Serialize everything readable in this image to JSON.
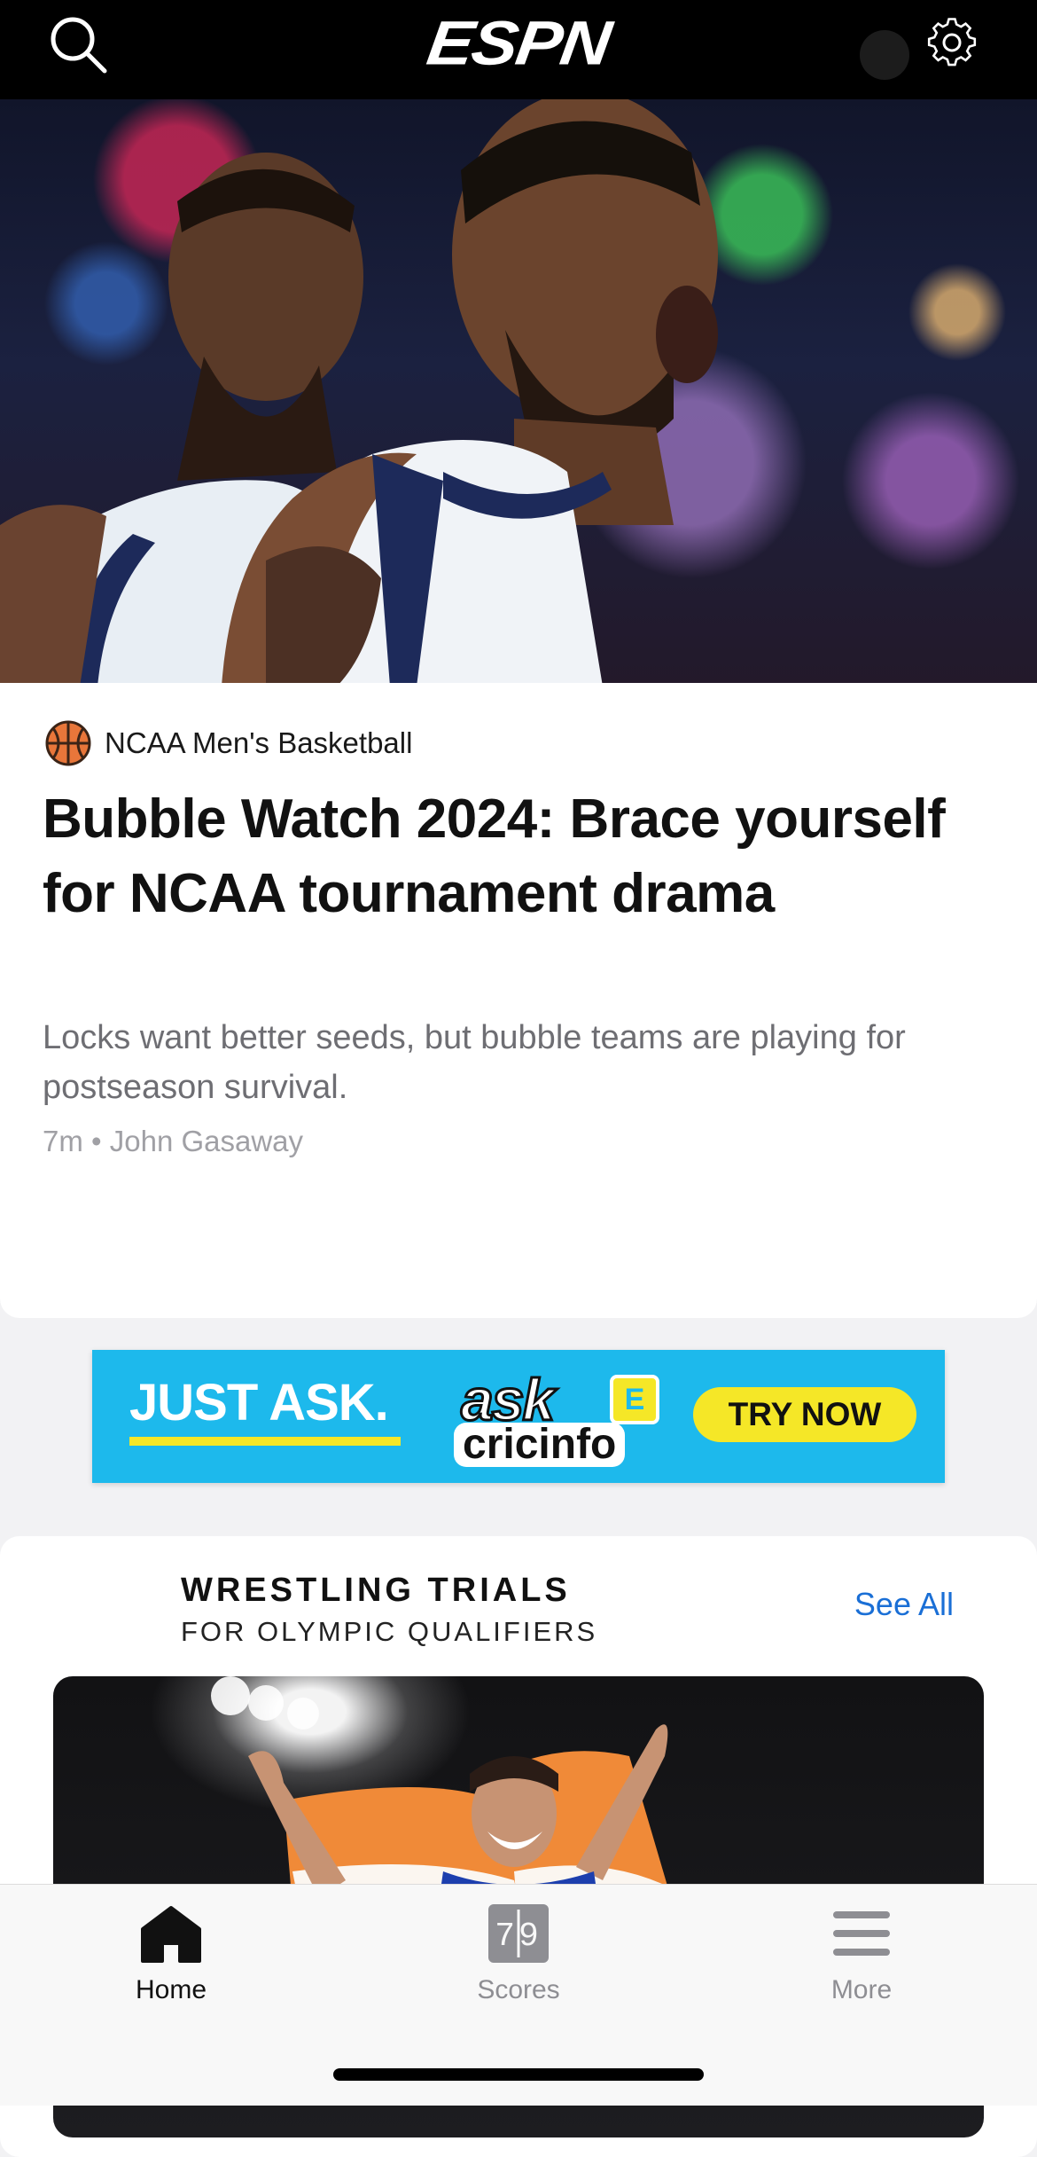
{
  "header": {
    "logo_text": "ESPN",
    "search_icon": "search-icon",
    "settings_icon": "gear-icon"
  },
  "hero_story": {
    "category": "NCAA Men's Basketball",
    "category_icon": "basketball-icon",
    "headline": "Bubble Watch 2024: Brace yourself for NCAA tournament drama",
    "summary": "Locks want better seeds, but bubble teams are playing for postseason survival.",
    "meta": "7m • John Gasaway"
  },
  "ad": {
    "tagline": "JUST ASK.",
    "brand_top": "ask",
    "brand_badge": "E",
    "brand_bottom": "cricinfo",
    "cta": "TRY NOW",
    "colors": {
      "background": "#1db9ec",
      "accent": "#f5e727"
    }
  },
  "section": {
    "title": "WRESTLING TRIALS",
    "subtitle": "FOR OLYMPIC QUALIFIERS",
    "see_all": "See All"
  },
  "tabbar": {
    "tabs": [
      {
        "label": "Home",
        "icon": "home-icon",
        "active": true
      },
      {
        "label": "Scores",
        "icon": "scores-icon",
        "icon_text": "79",
        "active": false
      },
      {
        "label": "More",
        "icon": "menu-icon",
        "active": false
      }
    ]
  },
  "colors": {
    "link": "#1a6fd6",
    "header_bg": "#000000"
  }
}
